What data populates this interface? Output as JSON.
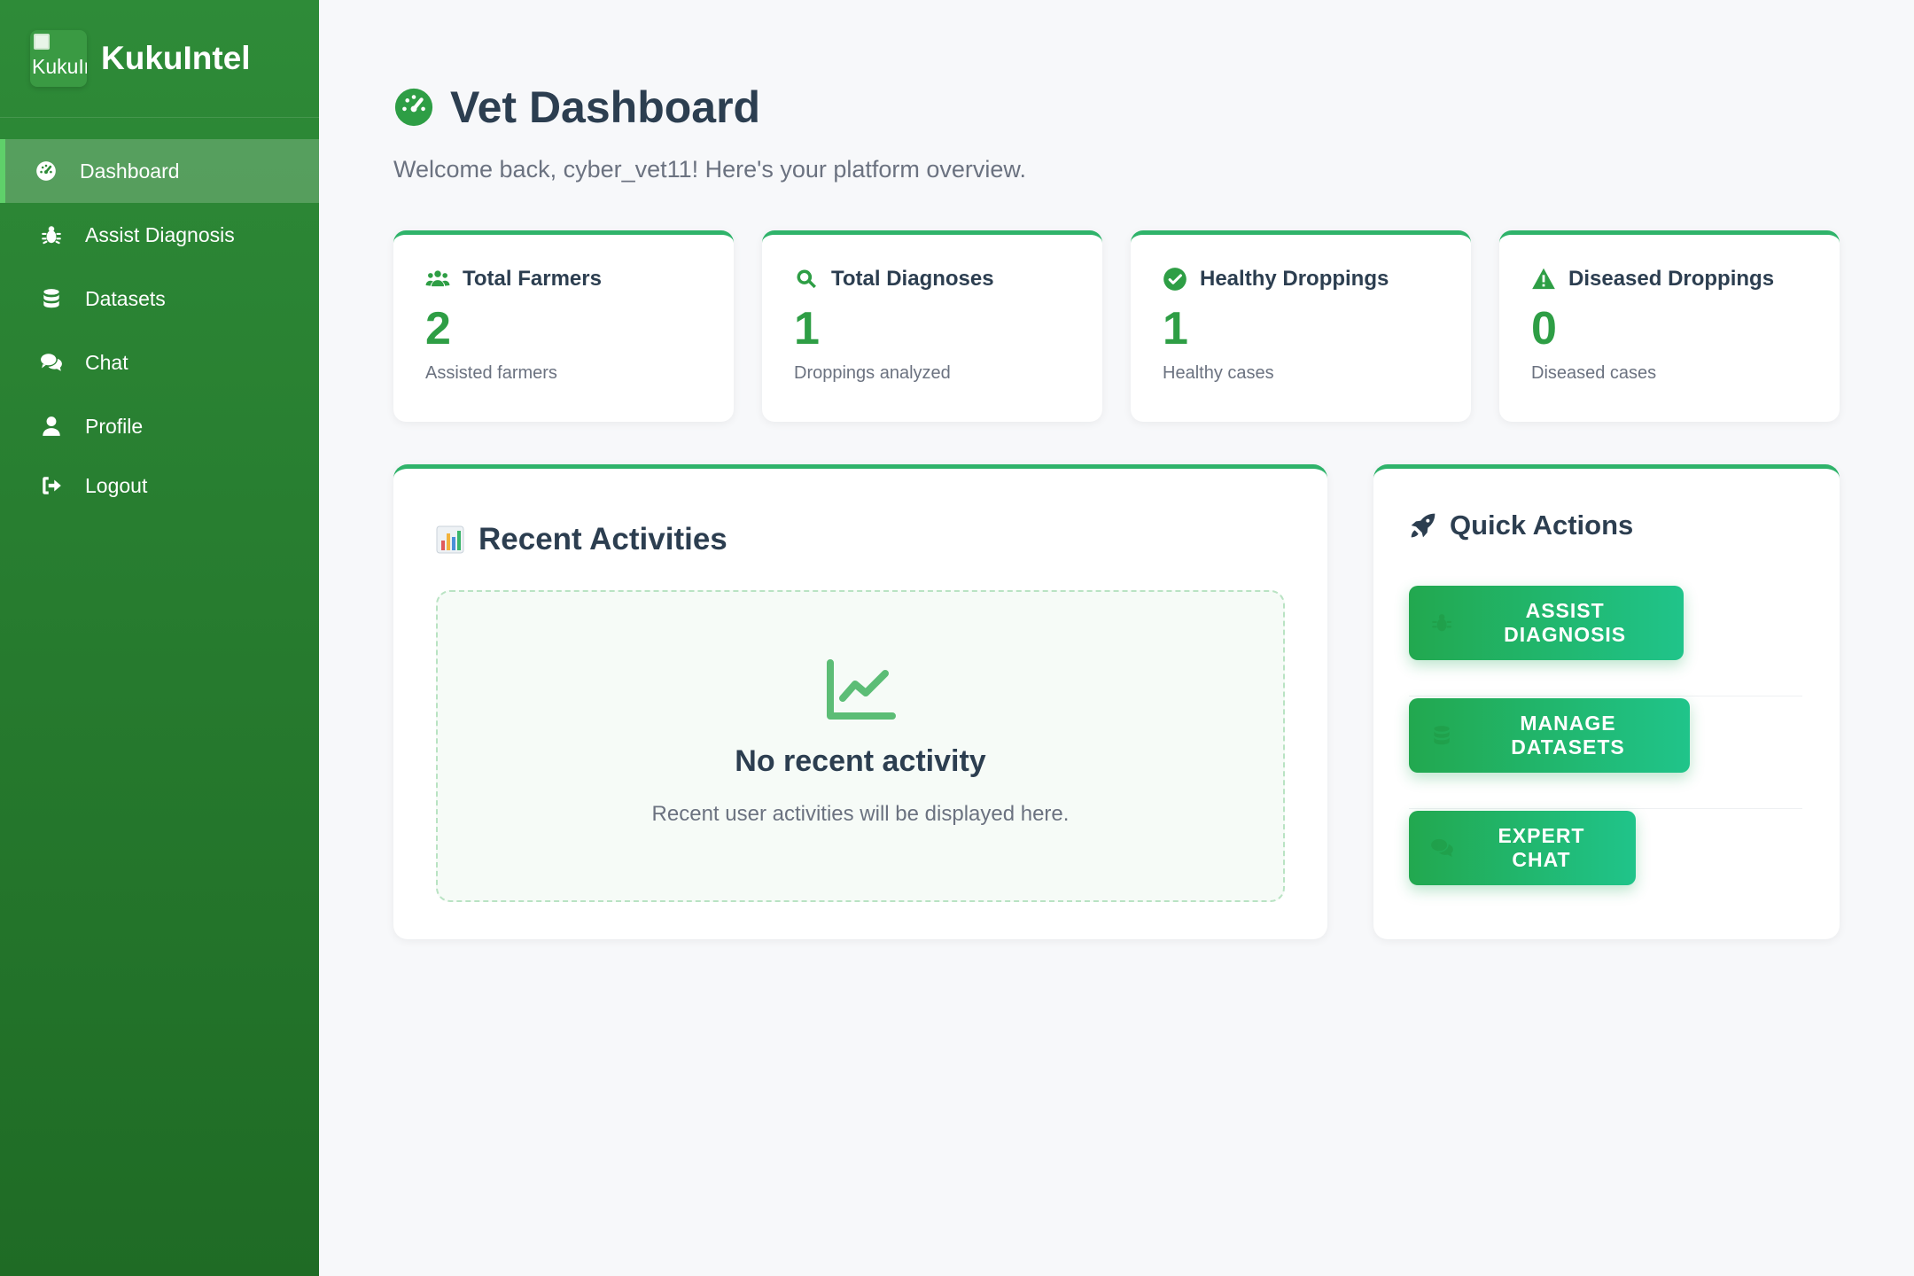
{
  "brand": {
    "logo_alt": "KukuIntel",
    "name": "KukuIntel"
  },
  "nav": {
    "items": [
      {
        "label": "Dashboard",
        "icon": "tachometer-icon",
        "active": true
      },
      {
        "label": "Assist Diagnosis",
        "icon": "bug-icon"
      },
      {
        "label": "Datasets",
        "icon": "database-icon"
      },
      {
        "label": "Chat",
        "icon": "comments-icon"
      },
      {
        "label": "Profile",
        "icon": "user-icon"
      },
      {
        "label": "Logout",
        "icon": "sign-out-icon"
      }
    ]
  },
  "header": {
    "title": "Vet Dashboard",
    "subtitle": "Welcome back, cyber_vet11! Here's your platform overview."
  },
  "stats": [
    {
      "title": "Total Farmers",
      "value": "2",
      "label": "Assisted farmers",
      "icon": "users-icon"
    },
    {
      "title": "Total Diagnoses",
      "value": "1",
      "label": "Droppings analyzed",
      "icon": "search-icon"
    },
    {
      "title": "Healthy Droppings",
      "value": "1",
      "label": "Healthy cases",
      "icon": "check-circle-icon"
    },
    {
      "title": "Diseased Droppings",
      "value": "0",
      "label": "Diseased cases",
      "icon": "warning-icon"
    }
  ],
  "recent": {
    "title": "Recent Activities",
    "empty_title": "No recent activity",
    "empty_text": "Recent user activities will be displayed here."
  },
  "quick_actions": {
    "title": "Quick Actions",
    "buttons": [
      {
        "label": "ASSIST DIAGNOSIS",
        "icon": "bug-icon"
      },
      {
        "label": "MANAGE DATASETS",
        "icon": "database-icon"
      },
      {
        "label": "EXPERT CHAT",
        "icon": "comments-icon"
      }
    ]
  },
  "colors": {
    "sidebar": "#2e8b38",
    "accent": "#2e9e45",
    "button_gradient_start": "#22a84f",
    "button_gradient_end": "#20c48a"
  }
}
